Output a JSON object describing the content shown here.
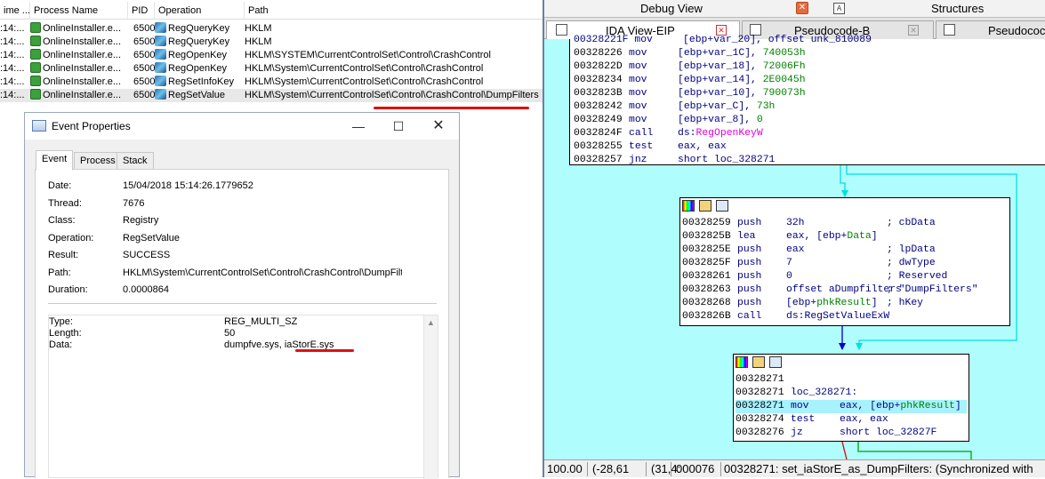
{
  "procmon": {
    "columns": [
      "ime ...",
      "Process Name",
      "PID",
      "Operation",
      "Path"
    ],
    "rows": [
      {
        "time": ":14:...",
        "process": "OnlineInstaller.e...",
        "pid": "6500",
        "operation": "RegQueryKey",
        "path": "HKLM"
      },
      {
        "time": ":14:...",
        "process": "OnlineInstaller.e...",
        "pid": "6500",
        "operation": "RegQueryKey",
        "path": "HKLM"
      },
      {
        "time": ":14:...",
        "process": "OnlineInstaller.e...",
        "pid": "6500",
        "operation": "RegOpenKey",
        "path": "HKLM\\SYSTEM\\CurrentControlSet\\Control\\CrashControl"
      },
      {
        "time": ":14:...",
        "process": "OnlineInstaller.e...",
        "pid": "6500",
        "operation": "RegOpenKey",
        "path": "HKLM\\System\\CurrentControlSet\\Control\\CrashControl"
      },
      {
        "time": ":14:...",
        "process": "OnlineInstaller.e...",
        "pid": "6500",
        "operation": "RegSetInfoKey",
        "path": "HKLM\\System\\CurrentControlSet\\Control\\CrashControl"
      },
      {
        "time": ":14:...",
        "process": "OnlineInstaller.e...",
        "pid": "6500",
        "operation": "RegSetValue",
        "path": "HKLM\\System\\CurrentControlSet\\Control\\CrashControl\\DumpFilters"
      }
    ]
  },
  "dialog": {
    "title": "Event Properties",
    "tabs": [
      "Event",
      "Process",
      "Stack"
    ],
    "fields": [
      {
        "label": "Date:",
        "value": "15/04/2018 15:14:26.1779652"
      },
      {
        "label": "Thread:",
        "value": "7676"
      },
      {
        "label": "Class:",
        "value": "Registry"
      },
      {
        "label": "Operation:",
        "value": "RegSetValue"
      },
      {
        "label": "Result:",
        "value": "SUCCESS"
      },
      {
        "label": "Path:",
        "value": "HKLM\\System\\CurrentControlSet\\Control\\CrashControl\\DumpFilte"
      },
      {
        "label": "Duration:",
        "value": "0.0000864"
      }
    ],
    "details": [
      {
        "label": "Type:",
        "value": "REG_MULTI_SZ"
      },
      {
        "label": "Length:",
        "value": "50"
      },
      {
        "label": "Data:",
        "value": "dumpfve.sys, iaStorE.sys"
      }
    ]
  },
  "ida": {
    "top_tabs": [
      "Debug View",
      "Structures"
    ],
    "tabs": [
      "IDA View-EIP",
      "Pseudocode-B",
      "Pseudococ"
    ],
    "block1": [
      [
        "00328226",
        "mov",
        "[ebp+var_1C], ",
        "740053h",
        ""
      ],
      [
        "0032822D",
        "mov",
        "[ebp+var_18], ",
        "72006Fh",
        ""
      ],
      [
        "00328234",
        "mov",
        "[ebp+var_14], ",
        "2E0045h",
        ""
      ],
      [
        "0032823B",
        "mov",
        "[ebp+var_10], ",
        "790073h",
        ""
      ],
      [
        "00328242",
        "mov",
        "[ebp+var_C], ",
        "73h",
        ""
      ],
      [
        "00328249",
        "mov",
        "[ebp+var_8], ",
        "0",
        ""
      ],
      [
        "0032824F",
        "call",
        "ds:",
        "RegOpenKeyW",
        ""
      ],
      [
        "00328255",
        "test",
        "eax, eax",
        "",
        ""
      ],
      [
        "00328257",
        "jnz",
        "short loc_328271",
        "",
        ""
      ]
    ],
    "block1_partial": "00328221F mov     [ebp+var_20], offset unk_810089",
    "block2": [
      [
        "00328259",
        "push",
        "32h",
        "; cbData"
      ],
      [
        "0032825B",
        "lea",
        "eax, [ebp+Data]",
        ""
      ],
      [
        "0032825E",
        "push",
        "eax",
        "; lpData"
      ],
      [
        "0032825F",
        "push",
        "7",
        "; dwType"
      ],
      [
        "00328261",
        "push",
        "0",
        "; Reserved"
      ],
      [
        "00328263",
        "push",
        "offset aDumpfilters",
        "; \"DumpFilters\""
      ],
      [
        "00328268",
        "push",
        "[ebp+phkResult]",
        "; hKey"
      ],
      [
        "0032826B",
        "call",
        "ds:RegSetValueExW",
        ""
      ]
    ],
    "block3": [
      [
        "00328271",
        "",
        "",
        ""
      ],
      [
        "00328271",
        "loc_328271:",
        "",
        ""
      ],
      [
        "00328271",
        "mov",
        "eax, [ebp+phkResult]",
        ""
      ],
      [
        "00328274",
        "test",
        "eax, eax",
        ""
      ],
      [
        "00328276",
        "jz",
        "short loc_32827F",
        ""
      ]
    ],
    "status": [
      "100.00",
      "(-28,61",
      "(31,4:",
      "000076",
      "00328271: set_iaStorE_as_DumpFilters: (Synchronized with"
    ]
  }
}
